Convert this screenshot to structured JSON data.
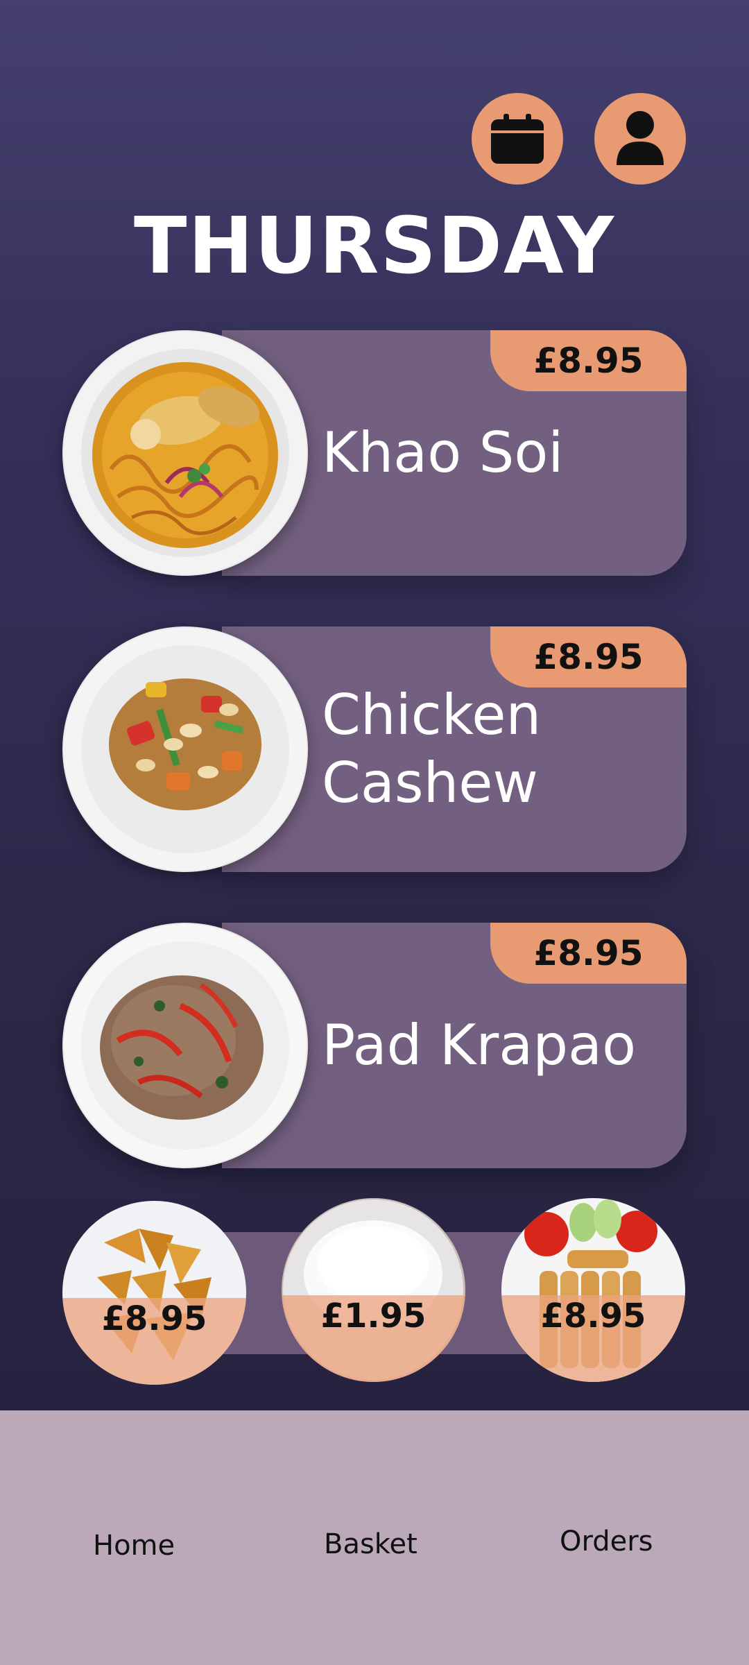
{
  "header": {
    "day": "THURSDAY",
    "calendar_icon": "calendar-icon",
    "profile_icon": "user-icon",
    "accent_color": "#e89a72"
  },
  "dishes": [
    {
      "name": "Khao Soi",
      "price": "£8.95"
    },
    {
      "name": "Chicken\nCashew",
      "price": "£8.95"
    },
    {
      "name": "Pad Krapao",
      "price": "£8.95"
    }
  ],
  "sides": [
    {
      "price": "£8.95"
    },
    {
      "price": "£1.95"
    },
    {
      "price": "£8.95"
    }
  ],
  "nav": {
    "home": "Home",
    "basket": "Basket",
    "orders": "Orders"
  }
}
